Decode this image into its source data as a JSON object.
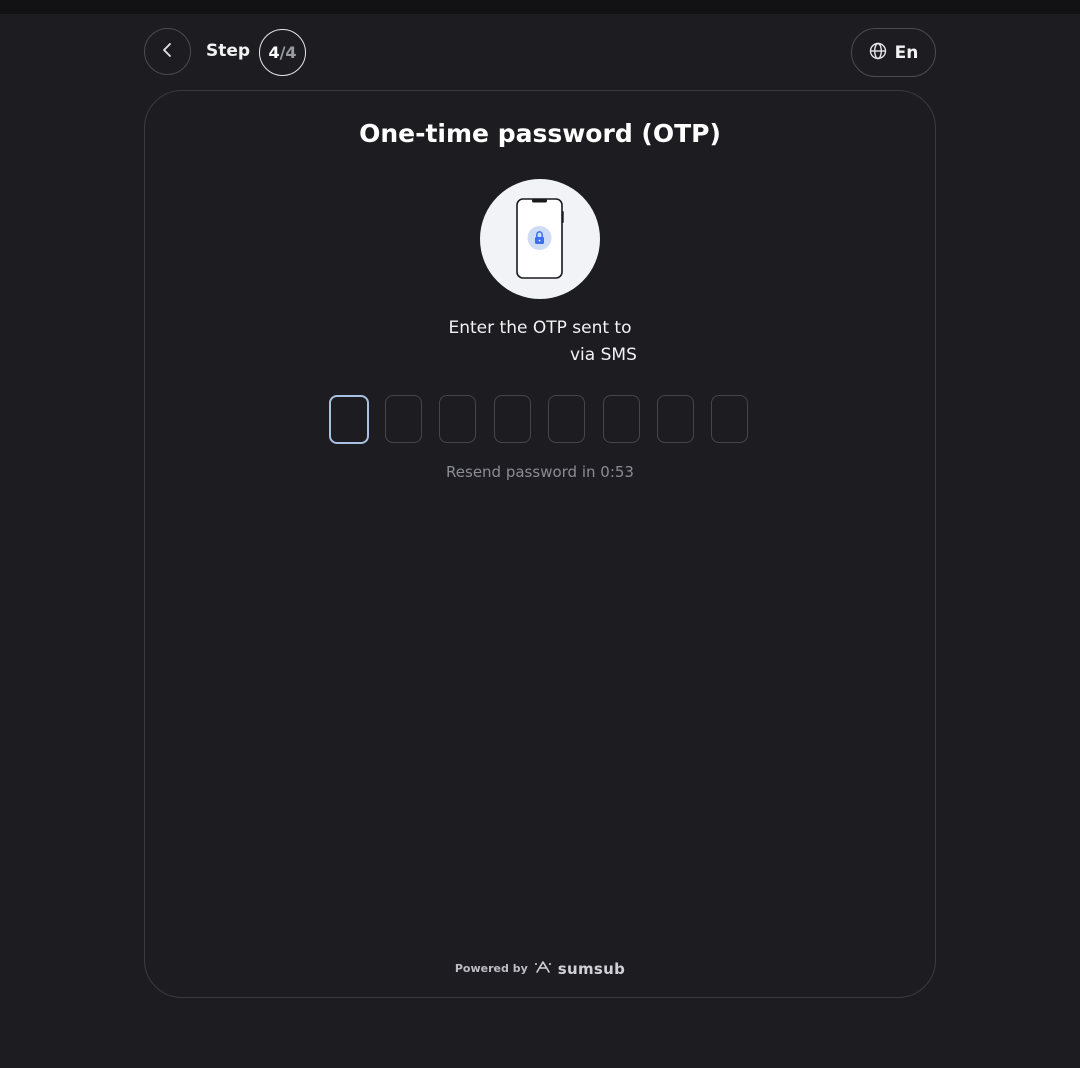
{
  "header": {
    "step_label": "Step",
    "step_current": "4",
    "step_separator": "/",
    "step_total": "4",
    "back_icon": "chevron-left-icon",
    "language_icon": "globe-icon",
    "language": "En"
  },
  "card": {
    "title": "One-time password (OTP)",
    "illustration_icon": "phone-lock-icon",
    "instruction_line1": "Enter the OTP sent to",
    "instruction_line2": "via SMS",
    "otp_length": 8,
    "otp_values": [
      "",
      "",
      "",
      "",
      "",
      "",
      "",
      ""
    ],
    "resend_text": "Resend password in 0:53"
  },
  "footer": {
    "powered_by": "Powered by",
    "brand_icon": "sumsub-logo-icon",
    "brand": "sumsub"
  },
  "colors": {
    "background": "#1d1d21",
    "card_border": "#3a3a40",
    "active_input_border": "#a9bfe3",
    "accent_lock": "#3d6ef0",
    "muted_text": "#8b8b93"
  }
}
